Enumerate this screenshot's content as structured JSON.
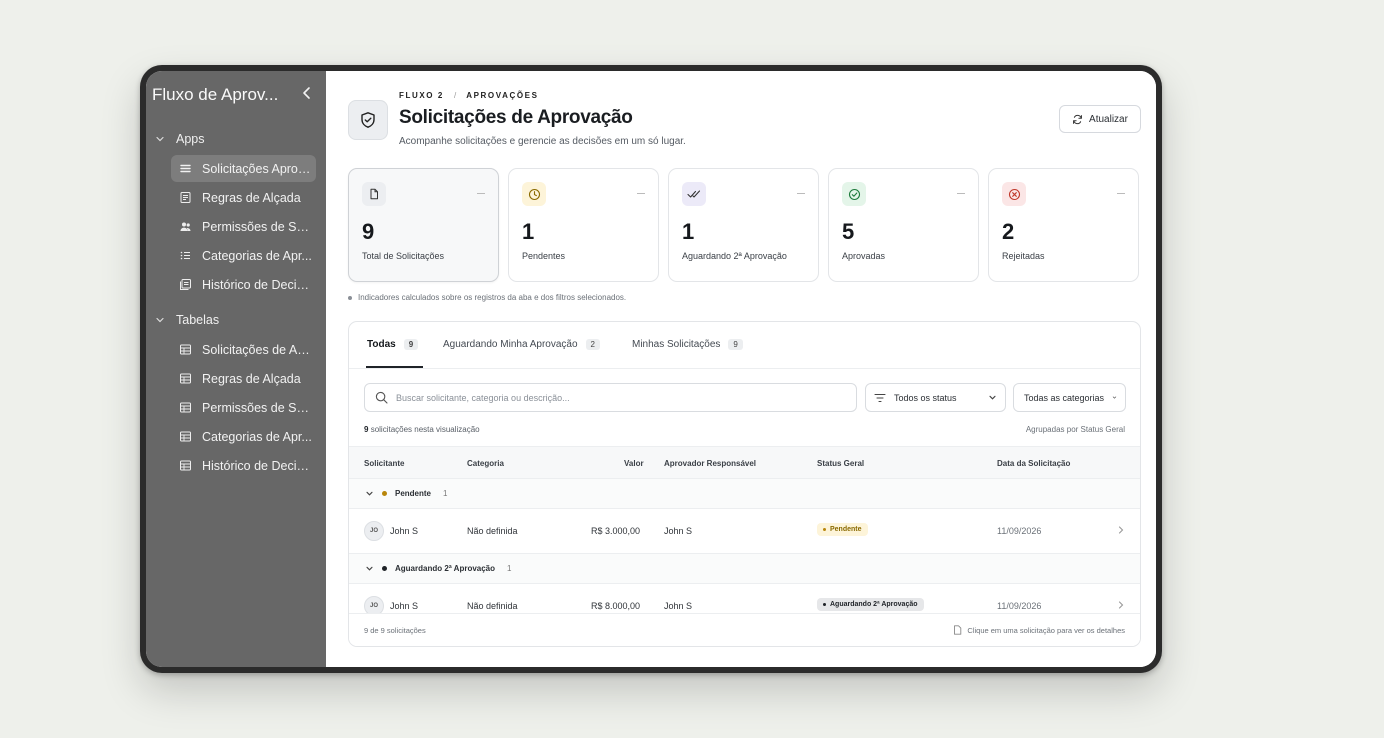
{
  "sidebar": {
    "title": "Fluxo de Aprov...",
    "sections": [
      {
        "label": "Apps",
        "items": [
          {
            "label": "Solicitações Aprov...",
            "icon": "list-icon",
            "active": true
          },
          {
            "label": "Regras de Alçada",
            "icon": "document-icon"
          },
          {
            "label": "Permissões de Sol...",
            "icon": "users-icon"
          },
          {
            "label": "Categorias de Apr...",
            "icon": "list-numbered-icon"
          },
          {
            "label": "Histórico de Decis...",
            "icon": "history-icon"
          }
        ]
      },
      {
        "label": "Tabelas",
        "items": [
          {
            "label": "Solicitações de Ap...",
            "icon": "table-icon"
          },
          {
            "label": "Regras de Alçada",
            "icon": "table-icon"
          },
          {
            "label": "Permissões de Sol...",
            "icon": "table-icon"
          },
          {
            "label": "Categorias de Apr...",
            "icon": "table-icon"
          },
          {
            "label": "Histórico de Decis...",
            "icon": "table-icon"
          }
        ]
      }
    ]
  },
  "header": {
    "crumb_1": "FLUXO 2",
    "crumb_sep": "/",
    "crumb_2": "APROVAÇÕES",
    "title": "Solicitações de Aprovação",
    "subtitle": "Acompanhe solicitações e gerencie as decisões em um só lugar.",
    "refresh_label": "Atualizar"
  },
  "stats": [
    {
      "value": "9",
      "label": "Total de Solicitações",
      "icon": "file-icon",
      "icon_bg": "#eceef1",
      "icon_color": "#333333"
    },
    {
      "value": "1",
      "label": "Pendentes",
      "icon": "clock-icon",
      "icon_bg": "#fdf4d9",
      "icon_color": "#8a6a00"
    },
    {
      "value": "1",
      "label": "Aguardando 2ª Aprovação",
      "icon": "double-check-icon",
      "icon_bg": "#eceaf8",
      "icon_color": "#333333"
    },
    {
      "value": "5",
      "label": "Aprovadas",
      "icon": "check-circle-icon",
      "icon_bg": "#e4f5e9",
      "icon_color": "#1e7a3c"
    },
    {
      "value": "2",
      "label": "Rejeitadas",
      "icon": "x-circle-icon",
      "icon_bg": "#fbe6e6",
      "icon_color": "#c0392b"
    }
  ],
  "note": "Indicadores calculados sobre os registros da aba e dos filtros selecionados.",
  "tabs": [
    {
      "label": "Todas",
      "count": "9",
      "active": true
    },
    {
      "label": "Aguardando Minha Aprovação",
      "count": "2"
    },
    {
      "label": "Minhas Solicitações",
      "count": "9"
    }
  ],
  "filters": {
    "search_placeholder": "Buscar solicitante, categoria ou descrição...",
    "status_value": "Todos os status",
    "category_value": "Todas as categorias"
  },
  "meta": {
    "count": "9",
    "count_suffix": "solicitações nesta visualização",
    "grouping": "Agrupadas por Status Geral"
  },
  "table": {
    "columns": [
      "Solicitante",
      "Categoria",
      "Valor",
      "Aprovador Responsável",
      "Status Geral",
      "Data da Solicitação"
    ],
    "groups": [
      {
        "name": "Pendente",
        "count": "1",
        "dot_color": "#b8860b",
        "rows": [
          {
            "initials": "JO",
            "requester": "John S",
            "category": "Não definida",
            "value": "R$ 3.000,00",
            "approver": "John S",
            "status": "Pendente",
            "status_bg": "#fdf4d9",
            "status_color": "#8a6a00",
            "date": "11/09/2026"
          }
        ]
      },
      {
        "name": "Aguardando 2ª Aprovação",
        "count": "1",
        "dot_color": "#1f2328",
        "rows": [
          {
            "initials": "JO",
            "requester": "John S",
            "category": "Não definida",
            "value": "R$ 8.000,00",
            "approver": "John S",
            "status": "Aguardando 2ª Aprovação",
            "status_bg": "#e6e7e9",
            "status_color": "#1f2328",
            "date": "11/09/2026"
          }
        ]
      }
    ]
  },
  "footer": {
    "left": "9 de 9 solicitações",
    "right": "Clique em uma solicitação para ver os detalhes"
  }
}
